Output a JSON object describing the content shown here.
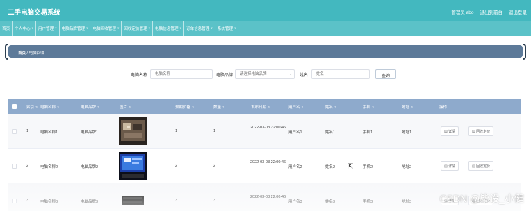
{
  "header": {
    "title": "二手电脑交易系统",
    "admin_text": "管理员 abo",
    "front_link": "退出到前台",
    "logout_link": "退出登录"
  },
  "nav": {
    "items": [
      {
        "label": "首页",
        "has_caret": false
      },
      {
        "label": "个人中心",
        "has_caret": true
      },
      {
        "label": "用户管理",
        "has_caret": true
      },
      {
        "label": "电脑品牌管理",
        "has_caret": true
      },
      {
        "label": "电脑回收管理",
        "has_caret": true
      },
      {
        "label": "回收定价管理",
        "has_caret": true
      },
      {
        "label": "电脑信息管理",
        "has_caret": true
      },
      {
        "label": "订单信息管理",
        "has_caret": true
      },
      {
        "label": "系统管理",
        "has_caret": true
      }
    ]
  },
  "breadcrumb": {
    "home": "首页",
    "separator": "/",
    "current": "电脑回收"
  },
  "search": {
    "name_label": "电脑名称",
    "name_placeholder": "电脑名称",
    "brand_label": "电脑品牌",
    "brand_placeholder": "请选择电脑品牌",
    "person_label": "姓名",
    "person_placeholder": "姓名",
    "button_label": "查询"
  },
  "table": {
    "columns": [
      "索引",
      "电脑名称",
      "电脑品牌",
      "图片",
      "预期价格",
      "数量",
      "发布日期",
      "用户名",
      "姓名",
      "手机",
      "地址",
      "操作"
    ],
    "rows": [
      {
        "index": "1",
        "name": "电脑名称1",
        "brand": "电脑品牌1",
        "price": "1",
        "qty": "1",
        "date": "2022-03-03 22:00:46",
        "username": "用户名1",
        "person": "姓名1",
        "phone": "手机1",
        "address": "地址1"
      },
      {
        "index": "2",
        "name": "电脑名称2",
        "brand": "电脑品牌2",
        "price": "2",
        "qty": "2",
        "date": "2022-03-03 22:00:46",
        "username": "用户名2",
        "person": "姓名2",
        "phone": "手机2",
        "address": "地址2"
      },
      {
        "index": "3",
        "name": "电脑名称3",
        "brand": "电脑品牌3",
        "price": "3",
        "qty": "3",
        "date": "2022-03-03 22:00:46",
        "username": "用户名3",
        "person": "姓名3",
        "phone": "手机3",
        "address": "地址3"
      }
    ],
    "detail_label": "详情",
    "price_label": "回收定价"
  },
  "watermark": "CSDN @毕设_小健",
  "colors": {
    "header": "#43b8bf",
    "nav": "#5bc2c8",
    "breadcrumb": "#5d7a99",
    "table_header": "#8eaacc"
  }
}
